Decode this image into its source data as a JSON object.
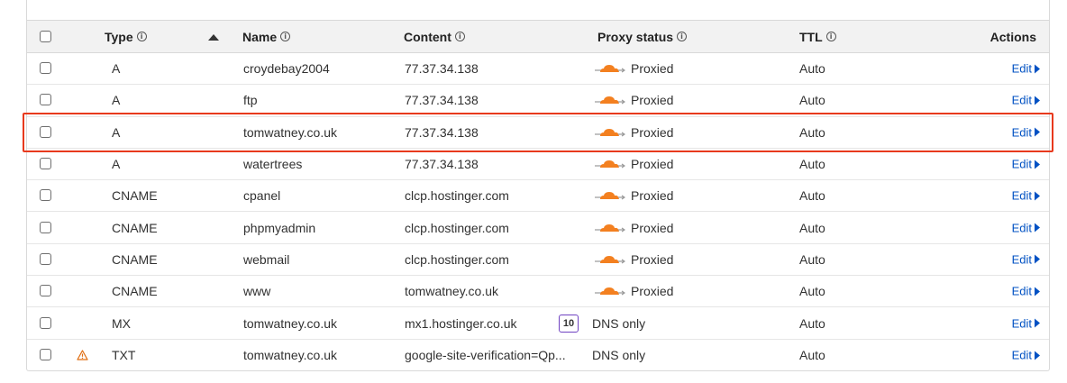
{
  "header": {
    "type": "Type",
    "name": "Name",
    "content": "Content",
    "proxy_status": "Proxy status",
    "ttl": "TTL",
    "actions": "Actions",
    "info_glyph": "i"
  },
  "records": [
    {
      "type": "A",
      "name": "croydebay2004",
      "content": "77.37.34.138",
      "proxy": "Proxied",
      "proxied": true,
      "ttl": "Auto",
      "action": "Edit"
    },
    {
      "type": "A",
      "name": "ftp",
      "content": "77.37.34.138",
      "proxy": "Proxied",
      "proxied": true,
      "ttl": "Auto",
      "action": "Edit"
    },
    {
      "type": "A",
      "name": "tomwatney.co.uk",
      "content": "77.37.34.138",
      "proxy": "Proxied",
      "proxied": true,
      "ttl": "Auto",
      "action": "Edit",
      "highlighted": true
    },
    {
      "type": "A",
      "name": "watertrees",
      "content": "77.37.34.138",
      "proxy": "Proxied",
      "proxied": true,
      "ttl": "Auto",
      "action": "Edit"
    },
    {
      "type": "CNAME",
      "name": "cpanel",
      "content": "clcp.hostinger.com",
      "proxy": "Proxied",
      "proxied": true,
      "ttl": "Auto",
      "action": "Edit"
    },
    {
      "type": "CNAME",
      "name": "phpmyadmin",
      "content": "clcp.hostinger.com",
      "proxy": "Proxied",
      "proxied": true,
      "ttl": "Auto",
      "action": "Edit"
    },
    {
      "type": "CNAME",
      "name": "webmail",
      "content": "clcp.hostinger.com",
      "proxy": "Proxied",
      "proxied": true,
      "ttl": "Auto",
      "action": "Edit"
    },
    {
      "type": "CNAME",
      "name": "www",
      "content": "tomwatney.co.uk",
      "proxy": "Proxied",
      "proxied": true,
      "ttl": "Auto",
      "action": "Edit"
    },
    {
      "type": "MX",
      "name": "tomwatney.co.uk",
      "content": "mx1.hostinger.co.uk",
      "priority": "10",
      "proxy": "DNS only",
      "proxied": false,
      "ttl": "Auto",
      "action": "Edit"
    },
    {
      "type": "TXT",
      "name": "tomwatney.co.uk",
      "content": "google-site-verification=Qp...",
      "proxy": "DNS only",
      "proxied": false,
      "ttl": "Auto",
      "action": "Edit",
      "warning": true
    }
  ],
  "colors": {
    "accent": "#0051c3",
    "cloud": "#f38020",
    "highlight": "#e8391d",
    "priority_border": "#6f42c1",
    "warning": "#e06d10"
  },
  "icons": {
    "sort": "sort-ascending-icon",
    "info": "info-icon",
    "cloud": "proxied-cloud-icon",
    "warning": "warning-triangle-icon",
    "edit": "chevron-right-icon"
  }
}
